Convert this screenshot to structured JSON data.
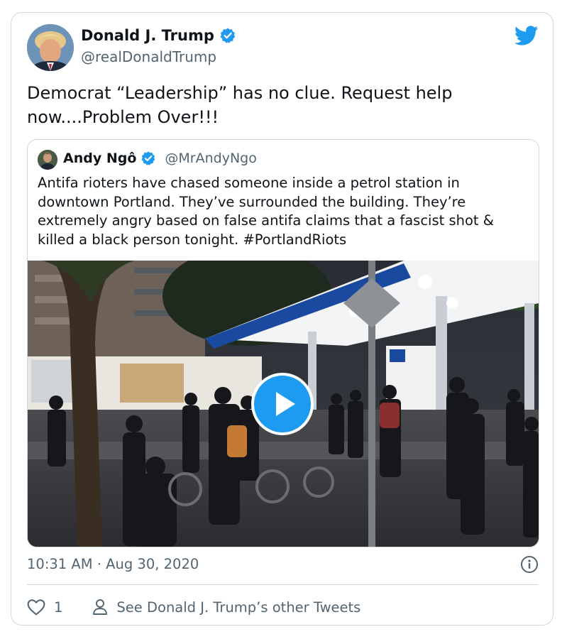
{
  "tweet": {
    "display_name": "Donald J. Trump",
    "handle": "@realDonaldTrump",
    "text": "Democrat “Leadership” has no clue. Request help\nnow....Problem Over!!!",
    "timestamp": "10:31 AM · Aug 30, 2020",
    "like_count": "1",
    "other_tweets_label": "See Donald J. Trump’s other Tweets"
  },
  "quoted_tweet": {
    "display_name": "Andy Ngô",
    "handle": "@MrAndyNgo",
    "text": "Antifa rioters have chased someone inside a petrol station in downtown Portland. They’ve surrounded the building. They’re extremely angry based on false antifa claims that a fascist shot & killed a black person tonight. #PortlandRiots"
  },
  "colors": {
    "accent": "#1d9bf0",
    "secondary_text": "#536471",
    "border": "#cfd9de"
  },
  "icons": {
    "verified": "verified-badge-icon",
    "brand": "twitter-bird-icon",
    "play": "play-icon",
    "info": "info-icon",
    "like": "heart-icon",
    "profile": "person-icon"
  }
}
